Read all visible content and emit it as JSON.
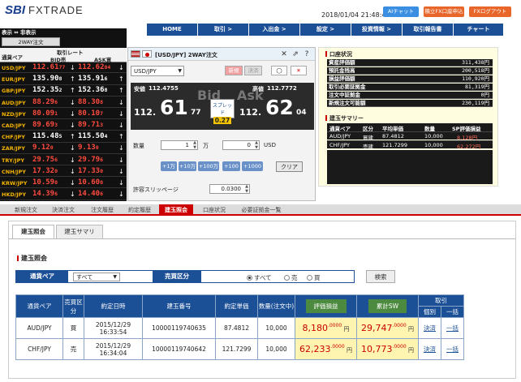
{
  "header": {
    "logo": "SBI",
    "logo_sub": "FXTRADE",
    "datetime": "2018/01/04 21:48:47",
    "chat_btn": "AIチャット",
    "open_btn": "積立FX口座申込",
    "logout_btn": "FXログアウト"
  },
  "menu": [
    "HOME",
    "取引 >",
    "入出金 >",
    "設定 >",
    "投資情報 >",
    "取引報告書",
    "チャート"
  ],
  "rate_board": {
    "toggle": "表示 ⇔ 非表示",
    "twoway": "2WAY注文",
    "col_pair": "通貨ペア",
    "col_rate": "取引レート",
    "col_bid": "BID売",
    "col_ask": "ASK買",
    "rows": [
      {
        "pair": "USD/JPY",
        "bid": "112.61",
        "bid_pip": "77",
        "ask": "112.62",
        "ask_pip": "04",
        "dir": "down"
      },
      {
        "pair": "EUR/JPY",
        "bid": "135.90",
        "bid_pip": "8",
        "ask": "135.91",
        "ask_pip": "6",
        "dir": "up"
      },
      {
        "pair": "GBP/JPY",
        "bid": "152.35",
        "bid_pip": "2",
        "ask": "152.36",
        "ask_pip": "8",
        "dir": "up"
      },
      {
        "pair": "AUD/JPY",
        "bid": "88.29",
        "bid_pip": "6",
        "ask": "88.30",
        "ask_pip": "8",
        "dir": "down"
      },
      {
        "pair": "NZD/JPY",
        "bid": "80.09",
        "bid_pip": "1",
        "ask": "80.10",
        "ask_pip": "7",
        "dir": "down"
      },
      {
        "pair": "CAD/JPY",
        "bid": "89.69",
        "bid_pip": "3",
        "ask": "89.71",
        "ask_pip": "3",
        "dir": "down"
      },
      {
        "pair": "CHF/JPY",
        "bid": "115.48",
        "bid_pip": "5",
        "ask": "115.50",
        "ask_pip": "4",
        "dir": "up"
      },
      {
        "pair": "ZAR/JPY",
        "bid": "9.12",
        "bid_pip": "0",
        "ask": "9.13",
        "ask_pip": "0",
        "dir": "down"
      },
      {
        "pair": "TRY/JPY",
        "bid": "29.75",
        "bid_pip": "6",
        "ask": "29.79",
        "ask_pip": "6",
        "dir": "down"
      },
      {
        "pair": "CNH/JPY",
        "bid": "17.32",
        "bid_pip": "0",
        "ask": "17.33",
        "ask_pip": "0",
        "dir": "down"
      },
      {
        "pair": "KRW/JPY",
        "bid": "10.59",
        "bid_pip": "0",
        "ask": "10.60",
        "ask_pip": "0",
        "dir": "down"
      },
      {
        "pair": "HKD/JPY",
        "bid": "14.39",
        "bid_pip": "6",
        "ask": "14.40",
        "ask_pip": "6",
        "dir": "down"
      }
    ]
  },
  "order_panel": {
    "title": "[USD/JPY] 2WAY注文",
    "pair_select": "USD/JPY",
    "new_btn": "新規",
    "settle_btn": "決済",
    "low_label": "安値",
    "low_value": "112.4755",
    "high_label": "高値",
    "high_value": "112.7772",
    "bid_label": "Bid",
    "ask_label": "Ask",
    "bid_pre": "112.",
    "bid_big": "61",
    "bid_suf": "77",
    "ask_pre": "112.",
    "ask_big": "62",
    "ask_suf": "04",
    "spread_label": "スプレッド",
    "spread_value": "0.27",
    "qty_label": "数量",
    "qty_value": "1",
    "qty_unit": "万",
    "qty2_value": "0",
    "qty2_unit": "USD",
    "quick_btns": [
      "+1万",
      "+10万",
      "+100万",
      "+100",
      "+1000"
    ],
    "clear_btn": "クリア",
    "slip_label": "許容スリッページ",
    "slip_value": "0.0300"
  },
  "account": {
    "title": "口座状況",
    "rows": [
      {
        "k": "資産評価額",
        "v": "311,438円"
      },
      {
        "k": "預託金残高",
        "v": "200,518円"
      },
      {
        "k": "損益評価額",
        "v": "110,920円"
      },
      {
        "k": "取引必要証拠金",
        "v": "81,319円"
      },
      {
        "k": "注文中証拠金",
        "v": "0円"
      },
      {
        "k": "新規注文可能額",
        "v": "230,119円"
      }
    ],
    "pos_title": "建玉サマリー",
    "pos_head": [
      "通貨ペア",
      "区分",
      "平均単価",
      "数量",
      "SP評価損益"
    ],
    "pos_rows": [
      {
        "pair": "AUD/JPY",
        "side": "買建",
        "avg": "87.4812",
        "qty": "10,000",
        "pl": "8,128円"
      },
      {
        "pair": "CHF/JPY",
        "side": "売建",
        "avg": "121.7299",
        "qty": "10,000",
        "pl": "62,272円"
      }
    ]
  },
  "func_tabs": [
    "新規注文",
    "決済注文",
    "注文履歴",
    "約定履歴",
    "建玉照会",
    "口座状況",
    "必要証拠金一覧"
  ],
  "func_active": 4,
  "sub_tabs": [
    "建玉照会",
    "建玉サマリ"
  ],
  "section_title": "建玉照会",
  "filter": {
    "pair_label": "通貨ペア",
    "pair_value": "すべて",
    "side_label": "売買区分",
    "opt_all": "すべて",
    "opt_sell": "売",
    "opt_buy": "買",
    "search_btn": "検索"
  },
  "table": {
    "headers": [
      "通貨ペア",
      "売買区分",
      "約定日時",
      "建玉番号",
      "約定単価",
      "数量(注文中)",
      "評価損益",
      "累計SW",
      "取引",
      "個別",
      "一括"
    ],
    "rows": [
      {
        "pair": "AUD/JPY",
        "side": "買",
        "date": "2015/12/29",
        "time": "16:33:54",
        "no": "10000119740635",
        "price": "87.4812",
        "qty": "10,000",
        "pl": "8,180",
        "pl_dec": ".0000",
        "sw": "29,747",
        "sw_dec": ".0000",
        "settle": "決済",
        "bulk": "一括"
      },
      {
        "pair": "CHF/JPY",
        "side": "売",
        "date": "2015/12/29",
        "time": "16:34:04",
        "no": "10000119740642",
        "price": "121.7299",
        "qty": "10,000",
        "pl": "62,233",
        "pl_dec": ".0000",
        "sw": "10,773",
        "sw_dec": ".0000",
        "settle": "決済",
        "bulk": "一括"
      }
    ],
    "yen": "円"
  }
}
